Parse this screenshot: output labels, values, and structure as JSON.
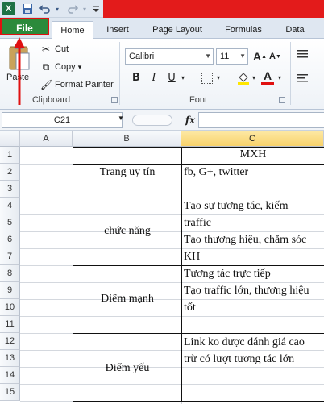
{
  "title_bar": {
    "app_icon": "X",
    "save_icon": "save-icon",
    "undo_icon": "undo-icon",
    "redo_icon": "redo-icon",
    "customize_icon": "chevron-down-icon"
  },
  "tabs": [
    {
      "label": "File"
    },
    {
      "label": "Home"
    },
    {
      "label": "Insert"
    },
    {
      "label": "Page Layout"
    },
    {
      "label": "Formulas"
    },
    {
      "label": "Data"
    }
  ],
  "clipboard": {
    "paste_label": "Paste",
    "cut_label": "Cut",
    "copy_label": "Copy",
    "copy_dropdown": "▾",
    "format_painter_label": "Format Painter",
    "group_label": "Clipboard"
  },
  "font": {
    "family": "Calibri",
    "size": "11",
    "bold": "B",
    "italic": "I",
    "underline": "U",
    "group_label": "Font",
    "font_color": "#e01010",
    "highlight_color": "#ffe600"
  },
  "formula_bar": {
    "name_box": "C21",
    "fx": "fx",
    "value": ""
  },
  "columns": [
    "A",
    "B",
    "C"
  ],
  "rows": [
    "1",
    "2",
    "3",
    "4",
    "5",
    "6",
    "7",
    "8",
    "9",
    "10",
    "11",
    "12",
    "13",
    "14",
    "15"
  ],
  "cells": {
    "c1": "MXH",
    "b_trang": "Trang uy tín",
    "c_trang": "fb, G+, twitter",
    "b_chucnang": "chức năng",
    "c_chucnang_1": "Tạo sự tương tác, kiếm",
    "c_chucnang_2": "traffic",
    "c_chucnang_3": "Tạo thương hiệu, chăm sóc",
    "c_chucnang_4": "KH",
    "b_diemmanh": "Điểm mạnh",
    "c_diemmanh_1": "Tương tác trực tiếp",
    "c_diemmanh_2": "Tạo traffic lớn, thương hiệu",
    "c_diemmanh_3": "tốt",
    "b_diemyeu": "Điểm yếu",
    "c_diemyeu_1": "Link ko được đánh giá cao",
    "c_diemyeu_2": "trừ có lượt tương tác lớn"
  },
  "colors": {
    "file_tab": "#2b8a3b",
    "highlight_box": "#e01010",
    "arrow": "#e01010"
  }
}
